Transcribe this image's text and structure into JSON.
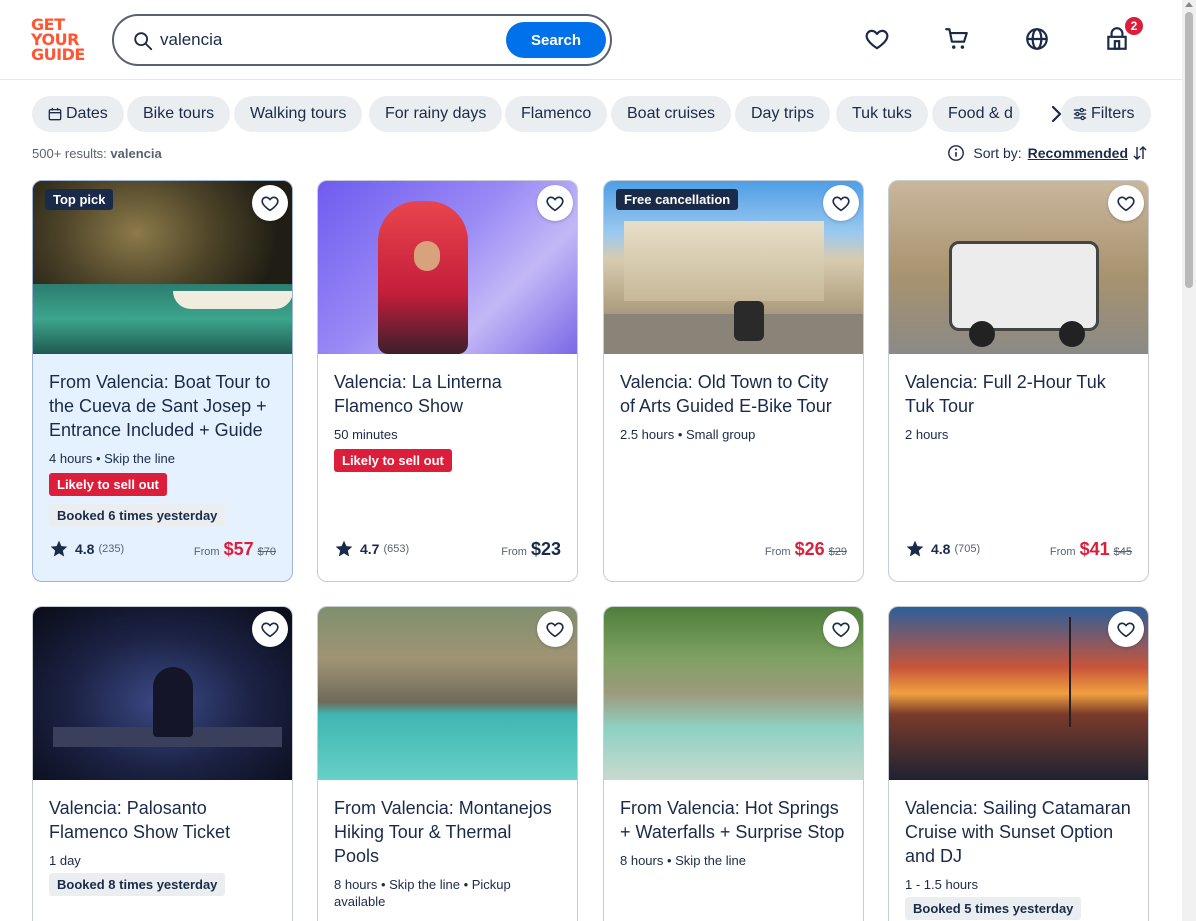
{
  "brand": {
    "logo_lines": [
      "GET",
      "YOUR",
      "GUIDE"
    ]
  },
  "search": {
    "value": "valencia",
    "button_label": "Search"
  },
  "header": {
    "cart_badge": "2"
  },
  "chips": [
    "Dates",
    "Bike tours",
    "Walking tours",
    "For rainy days",
    "Flamenco",
    "Boat cruises",
    "Day trips",
    "Tuk tuks",
    "Food & d"
  ],
  "filters_label": "Filters",
  "results": {
    "count": "500+ results:",
    "query": "valencia"
  },
  "sort": {
    "label": "Sort by:",
    "value": "Recommended"
  },
  "cards": [
    {
      "ribbon": "Top pick",
      "title": "From Valencia: Boat Tour to the Cueva de Sant Josep + Entrance Included + Guide",
      "meta": "4 hours • Skip the line",
      "sell": "Likely to sell out",
      "booked": "Booked 6 times yesterday",
      "rating": "4.8",
      "reviews": "(235)",
      "from": "From",
      "price": "$57",
      "old": "$70"
    },
    {
      "title": "Valencia: La Linterna Flamenco Show",
      "meta": "50 minutes",
      "sell": "Likely to sell out",
      "rating": "4.7",
      "reviews": "(653)",
      "from": "From",
      "price": "$23"
    },
    {
      "ribbon": "Free cancellation",
      "title": "Valencia: Old Town to City of Arts Guided E-Bike Tour",
      "meta": "2.5 hours • Small group",
      "from": "From",
      "price": "$26",
      "old": "$29"
    },
    {
      "title": "Valencia: Full 2-Hour Tuk Tuk Tour",
      "meta": "2 hours",
      "rating": "4.8",
      "reviews": "(705)",
      "from": "From",
      "price": "$41",
      "old": "$45"
    },
    {
      "title": "Valencia: Palosanto Flamenco Show Ticket",
      "meta": "1 day",
      "booked": "Booked 8 times yesterday"
    },
    {
      "title": "From Valencia: Montanejos Hiking Tour & Thermal Pools",
      "meta": "8 hours • Skip the line • Pickup available"
    },
    {
      "title": "From Valencia: Hot Springs + Waterfalls + Surprise Stop",
      "meta": "8 hours • Skip the line"
    },
    {
      "title": "Valencia: Sailing Catamaran Cruise with Sunset Option and DJ",
      "meta": "1 - 1.5 hours",
      "booked": "Booked 5 times yesterday"
    }
  ],
  "colors": {
    "brand": "#ff5533",
    "primary": "#0071eb",
    "sale": "#dc1e3b",
    "navy": "#1a2b49"
  }
}
